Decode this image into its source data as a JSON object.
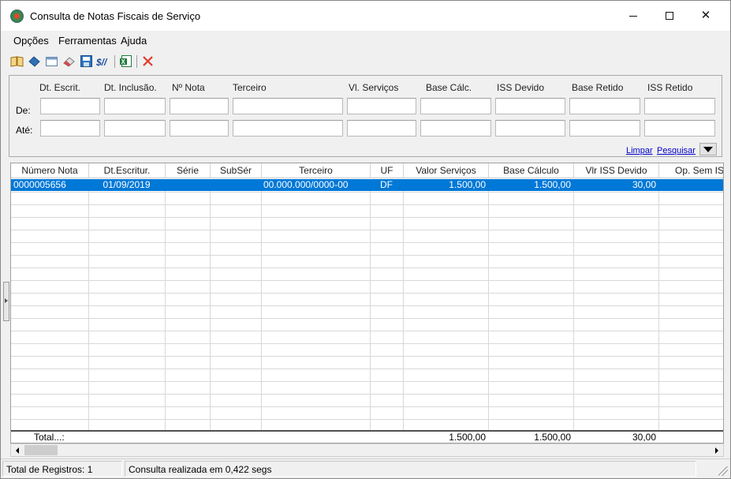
{
  "window": {
    "title": "Consulta de Notas Fiscais de Serviço",
    "controls": {
      "minimize": "minimize-icon",
      "maximize": "maximize-icon",
      "close": "✕"
    }
  },
  "menu": [
    "Opções",
    "Ferramentas",
    "Ajuda"
  ],
  "toolbar": [
    {
      "name": "open-book-icon",
      "color": "#c8901f"
    },
    {
      "name": "eraser-blue-icon",
      "color": "#2f6fb5"
    },
    {
      "name": "window-icon",
      "color": "#7a9cc6"
    },
    {
      "name": "eraser-icon",
      "color": "#b8b8b8"
    },
    {
      "name": "save-icon",
      "color": "#2b73c0"
    },
    {
      "name": "report-icon",
      "color": "#1f4fa0"
    },
    {
      "name": "excel-export-icon",
      "color": "#1f7a3c"
    },
    {
      "name": "close-red-icon",
      "color": "#e03a2a"
    }
  ],
  "filters": {
    "columns": [
      "Dt. Escrit.",
      "Dt. Inclusão.",
      "Nº Nota",
      "Terceiro",
      "Vl. Serviços",
      "Base Cálc.",
      "ISS Devido",
      "Base Retido",
      "ISS Retido"
    ],
    "row_from_label": "De:",
    "row_to_label": "Até:",
    "clear_link": "Limpar",
    "search_link": "Pesquisar"
  },
  "grid": {
    "headers": [
      "Número Nota",
      "Dt.Escritur.",
      "Série",
      "SubSér",
      "Terceiro",
      "UF",
      "Valor Serviços",
      "Base Cálculo",
      "Vlr ISS Devido",
      "Op. Sem ISS"
    ],
    "rows": [
      [
        "0000005656",
        "01/09/2019",
        "",
        "",
        "00.000.000/0000-00",
        "DF",
        "1.500,00",
        "1.500,00",
        "30,00",
        ""
      ]
    ],
    "totals": {
      "label": "Total...:",
      "valor_servicos": "1.500,00",
      "base_calculo": "1.500,00",
      "iss_devido": "30,00"
    }
  },
  "status": {
    "records": "Total de Registros: 1",
    "query_time": "Consulta realizada em 0,422 segs"
  },
  "colors": {
    "selection": "#0078d7",
    "link": "#0000cc"
  }
}
